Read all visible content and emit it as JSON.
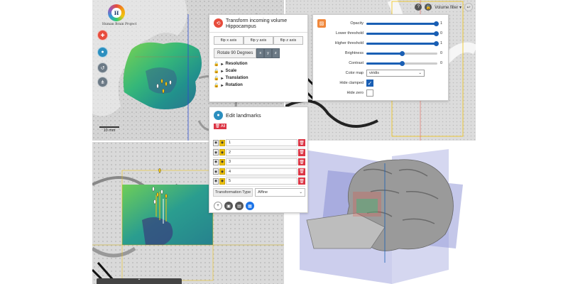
{
  "logo": {
    "text": "Human Brain Project",
    "mark": "H"
  },
  "topbar": {
    "volume_filter": "Volume filter ▾",
    "help_icon": "question-icon",
    "lock_icon": "unlock-icon",
    "logout_icon": "exit-icon"
  },
  "tools": [
    {
      "name": "brain-icon",
      "color": "#e74c3c"
    },
    {
      "name": "map-marker-icon",
      "color": "#2c8fbf"
    },
    {
      "name": "history-icon",
      "color": "#6c7a86"
    },
    {
      "name": "share-icon",
      "color": "#6c7a86"
    }
  ],
  "scalebar": {
    "label": "10 mm"
  },
  "transform": {
    "title": "Transform incoming volume Hippocampus",
    "flip_x": "flip x axis",
    "flip_y": "flip y axis",
    "flip_z": "flip z axis",
    "rotate": "Rotate 90 Degrees",
    "axis_x": "x",
    "axis_y": "y",
    "axis_z": "z",
    "sections": [
      "Resolution",
      "Scale",
      "Translation",
      "Rotation"
    ]
  },
  "landmarks": {
    "title": "Edit landmarks",
    "all_label": "All",
    "rows": [
      "1",
      "2",
      "3",
      "4",
      "5"
    ],
    "transformation_type_label": "Transformation Type",
    "transformation_type_value": "Affine"
  },
  "display": {
    "opacity": {
      "label": "Opacity",
      "value": "1",
      "level": 0.98
    },
    "lower_threshold": {
      "label": "Lower threshold",
      "value": "0",
      "level": 0.98
    },
    "higher_threshold": {
      "label": "Higher threshold",
      "value": "1",
      "level": 0.98
    },
    "brightness": {
      "label": "Brightness",
      "value": "0",
      "level": 0.5
    },
    "contrast": {
      "label": "Contrast",
      "value": "0",
      "level": 0.5
    },
    "color_map": {
      "label": "Color map",
      "value": "viridis"
    },
    "hide_clamped": {
      "label": "Hide clamped",
      "checked": true
    },
    "hide_zero": {
      "label": "Hide zero",
      "checked": false
    }
  },
  "colors": {
    "accent_blue": "#1a5fb4",
    "danger_red": "#dc3545",
    "viridis_green": "#3fb680"
  }
}
